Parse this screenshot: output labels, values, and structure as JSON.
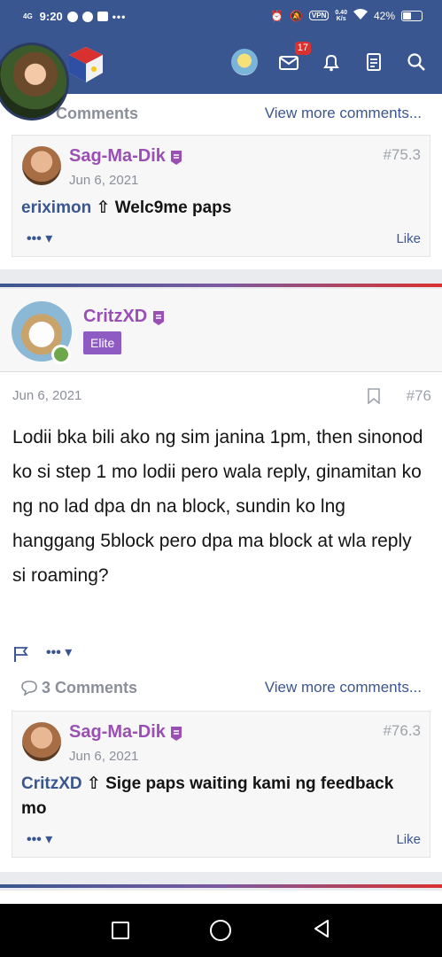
{
  "status_bar": {
    "network": "4G",
    "time": "9:20",
    "vpn": "VPN",
    "speed": "0.40",
    "speed_unit": "K/s",
    "battery": "42%",
    "battery_level": 0.42
  },
  "header": {
    "notifications_badge": "17"
  },
  "top_comments": {
    "title": "Comments",
    "view_more": "View more comments...",
    "comment": {
      "author": "Sag-Ma-Dik",
      "date": "Jun 6, 2021",
      "number": "#75.3",
      "quoted_user": "eriximon",
      "text": "Welc9me paps",
      "like": "Like"
    }
  },
  "post": {
    "author": "CritzXD",
    "role": "Elite",
    "date": "Jun 6, 2021",
    "number": "#76",
    "body": "Lodii bka bili ako ng sim janina 1pm, then sinonod ko si step 1 mo lodii pero wala reply, ginamitan ko ng no lad dpa dn na block, sundin ko lng hanggang 5block pero dpa ma block at wla reply si roaming?",
    "comments": {
      "title": "3 Comments",
      "view_more": "View more comments...",
      "comment": {
        "author": "Sag-Ma-Dik",
        "date": "Jun 6, 2021",
        "number": "#76.3",
        "quoted_user": "CritzXD",
        "text": "Sige paps waiting kami ng feedback mo",
        "like": "Like"
      }
    }
  },
  "colors": {
    "header_bg": "#3a5691",
    "username": "#9a4fb4",
    "link": "#3a5691",
    "elite_badge": "#8e5bc3",
    "notification_badge": "#d9312f"
  }
}
